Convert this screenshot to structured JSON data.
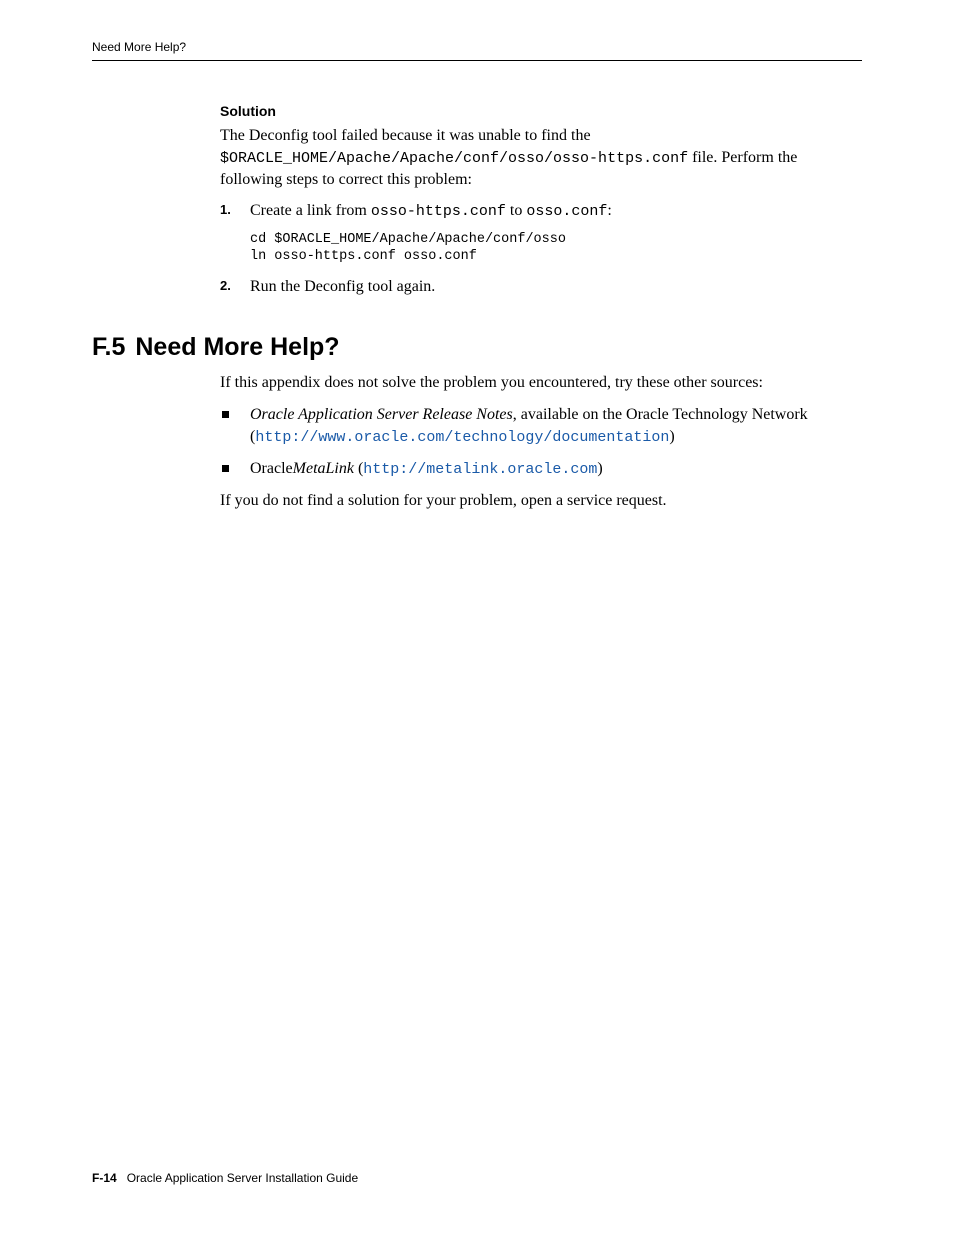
{
  "header": {
    "running_title": "Need More Help?"
  },
  "solution": {
    "heading": "Solution",
    "para_parts": {
      "a": "The Deconfig tool failed because it was unable to find the ",
      "b": "$ORACLE_HOME/Apache/Apache/conf/osso/osso-https.conf",
      "c": " file. Perform the following steps to correct this problem:"
    },
    "steps": [
      {
        "num": "1.",
        "text_a": "Create a link from ",
        "code_a": "osso-https.conf",
        "text_b": " to ",
        "code_b": "osso.conf",
        "text_c": ":",
        "codeblock": "cd $ORACLE_HOME/Apache/Apache/conf/osso\nln osso-https.conf osso.conf"
      },
      {
        "num": "2.",
        "text_a": "Run the Deconfig tool again."
      }
    ]
  },
  "section": {
    "num": "F.5",
    "title": "Need More Help?",
    "intro": "If this appendix does not solve the problem you encountered, try these other sources:",
    "bullets": [
      {
        "italic": "Oracle Application Server Release Notes",
        "after_italic": ", available on the Oracle Technology Network (",
        "link": "http://www.oracle.com/technology/documentation",
        "close": ")"
      },
      {
        "plain_a": "Oracle",
        "italic": "MetaLink",
        "after_italic": " (",
        "link": "http://metalink.oracle.com",
        "close": ")"
      }
    ],
    "outro": "If you do not find a solution for your problem, open a service request."
  },
  "footer": {
    "page_num": "F-14",
    "book_title": "Oracle Application Server Installation Guide"
  }
}
